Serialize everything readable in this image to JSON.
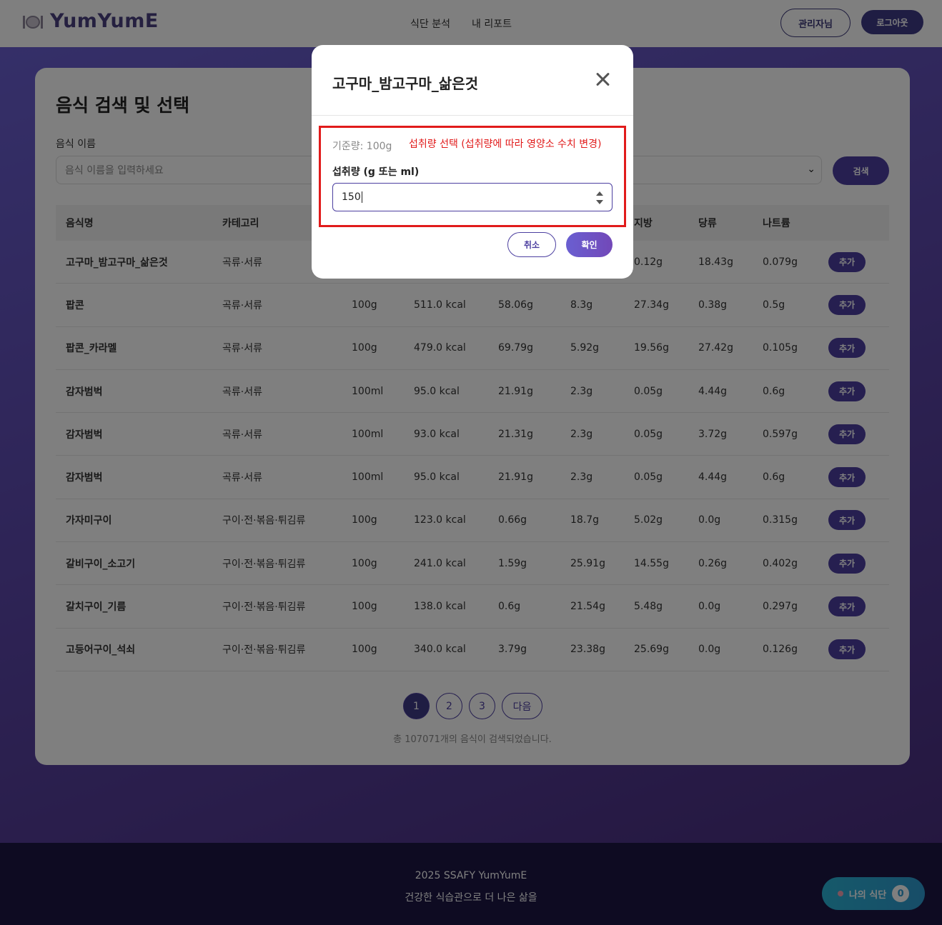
{
  "header": {
    "logo_text": "YumYumE",
    "nav": [
      "식단 분석",
      "내 리포트"
    ],
    "admin_label": "관리자님",
    "logout_label": "로그아웃"
  },
  "search": {
    "title": "음식 검색 및 선택",
    "field_label": "음식 이름",
    "placeholder": "음식 이름을 입력하세요",
    "button_label": "검색"
  },
  "table": {
    "headers": [
      "음식명",
      "카테고리",
      "",
      "",
      "",
      "",
      "지방",
      "당류",
      "나트륨"
    ],
    "add_label": "추가",
    "rows": [
      {
        "name": "고구마_밤고구마_삶은것",
        "category": "곡류·서류",
        "amount": "",
        "kcal": "",
        "carb": "",
        "protein": "",
        "fat": "0.12g",
        "sugar": "18.43g",
        "sodium": "0.079g"
      },
      {
        "name": "팝콘",
        "category": "곡류·서류",
        "amount": "100g",
        "kcal": "511.0 kcal",
        "carb": "58.06g",
        "protein": "8.3g",
        "fat": "27.34g",
        "sugar": "0.38g",
        "sodium": "0.5g"
      },
      {
        "name": "팝콘_카라멜",
        "category": "곡류·서류",
        "amount": "100g",
        "kcal": "479.0 kcal",
        "carb": "69.79g",
        "protein": "5.92g",
        "fat": "19.56g",
        "sugar": "27.42g",
        "sodium": "0.105g"
      },
      {
        "name": "감자범벅",
        "category": "곡류·서류",
        "amount": "100ml",
        "kcal": "95.0 kcal",
        "carb": "21.91g",
        "protein": "2.3g",
        "fat": "0.05g",
        "sugar": "4.44g",
        "sodium": "0.6g"
      },
      {
        "name": "감자범벅",
        "category": "곡류·서류",
        "amount": "100ml",
        "kcal": "93.0 kcal",
        "carb": "21.31g",
        "protein": "2.3g",
        "fat": "0.05g",
        "sugar": "3.72g",
        "sodium": "0.597g"
      },
      {
        "name": "감자범벅",
        "category": "곡류·서류",
        "amount": "100ml",
        "kcal": "95.0 kcal",
        "carb": "21.91g",
        "protein": "2.3g",
        "fat": "0.05g",
        "sugar": "4.44g",
        "sodium": "0.6g"
      },
      {
        "name": "가자미구이",
        "category": "구이·전·볶음·튀김류",
        "amount": "100g",
        "kcal": "123.0 kcal",
        "carb": "0.66g",
        "protein": "18.7g",
        "fat": "5.02g",
        "sugar": "0.0g",
        "sodium": "0.315g"
      },
      {
        "name": "갈비구이_소고기",
        "category": "구이·전·볶음·튀김류",
        "amount": "100g",
        "kcal": "241.0 kcal",
        "carb": "1.59g",
        "protein": "25.91g",
        "fat": "14.55g",
        "sugar": "0.26g",
        "sodium": "0.402g"
      },
      {
        "name": "갈치구이_기름",
        "category": "구이·전·볶음·튀김류",
        "amount": "100g",
        "kcal": "138.0 kcal",
        "carb": "0.6g",
        "protein": "21.54g",
        "fat": "5.48g",
        "sugar": "0.0g",
        "sodium": "0.297g"
      },
      {
        "name": "고등어구이_석쇠",
        "category": "구이·전·볶음·튀김류",
        "amount": "100g",
        "kcal": "340.0 kcal",
        "carb": "3.79g",
        "protein": "23.38g",
        "fat": "25.69g",
        "sugar": "0.0g",
        "sodium": "0.126g"
      }
    ]
  },
  "pagination": {
    "pages": [
      "1",
      "2",
      "3"
    ],
    "active": "1",
    "next_label": "다음",
    "result_text": "총 107071개의 음식이 검색되었습니다."
  },
  "footer": {
    "line1": "2025 SSAFY YumYumE",
    "line2": "건강한 식습관으로 더 나은 삶을"
  },
  "my_diet": {
    "label": "나의 식단",
    "count": "0"
  },
  "modal": {
    "title": "고구마_밤고구마_삶은것",
    "base_amount": "기준량: 100g",
    "annotation": "섭취량 선택 (섭취량에 따라 영양소 수치 변경)",
    "amount_label": "섭취량 (g 또는 ml)",
    "amount_value": "150",
    "cancel_label": "취소",
    "ok_label": "확인"
  },
  "colors": {
    "brand": "#4c3fa0",
    "annotation": "#e11b1b",
    "footer_bg": "#1c1744"
  }
}
